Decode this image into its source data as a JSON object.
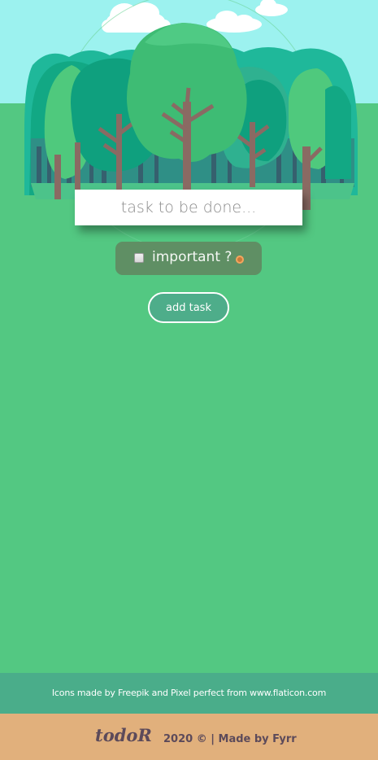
{
  "task_form": {
    "input_placeholder": "task to be done...",
    "input_value": "",
    "important_label": "important ?",
    "important_checked": false,
    "add_button_label": "add task"
  },
  "footer": {
    "credits": "Icons made by Freepik and Pixel perfect from www.flaticon.com",
    "logo": "todoR",
    "copyright": "2020 © | Made by Fyrr"
  },
  "colors": {
    "background_green": "#53c882",
    "sky": "#9cf2ef",
    "footer_teal": "#4aad8a",
    "footer_tan": "#e1b07c",
    "important_pill": "#5f8f64",
    "important_dot": "#f3a65f"
  },
  "icons": [
    "forest-illustration",
    "cloud-icon",
    "radio-dot-icon"
  ]
}
